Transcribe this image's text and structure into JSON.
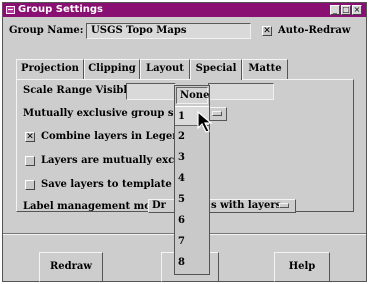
{
  "window": {
    "title": "Group Settings",
    "minimize_glyph": "_",
    "maximize_glyph": "□",
    "close_glyph": "×"
  },
  "header": {
    "group_name_label": "Group Name:",
    "group_name_value": "USGS Topo Maps",
    "auto_redraw_label": "Auto-Redraw",
    "auto_redraw_checked": true
  },
  "tabs": [
    {
      "label": "Projection",
      "active": false
    },
    {
      "label": "Clipping",
      "active": false
    },
    {
      "label": "Layout",
      "active": false
    },
    {
      "label": "Special",
      "active": true
    },
    {
      "label": "Matte",
      "active": false
    }
  ],
  "special": {
    "scale_range_label": "Scale Range Visible",
    "scale_min": "",
    "scale_max": "",
    "mutex_label": "Mutually exclusive group set:",
    "mutex_value": "1",
    "combine_label": "Combine layers in Legend",
    "combine_checked": true,
    "layers_mutex_label": "Layers are mutually exclu",
    "layers_mutex_checked": false,
    "save_template_label": "Save layers to template \"as",
    "save_template_checked": false,
    "label_mgmt_label": "Label management mode:",
    "label_mgmt_value_left": "Dr",
    "label_mgmt_value_right": "s with layers"
  },
  "dropdown": {
    "items": [
      "None",
      "1",
      "2",
      "3",
      "4",
      "5",
      "6",
      "7",
      "8"
    ],
    "selected": "1"
  },
  "buttons": {
    "redraw": "Redraw",
    "help": "Help"
  },
  "icons": {
    "check_mark": "✕"
  }
}
